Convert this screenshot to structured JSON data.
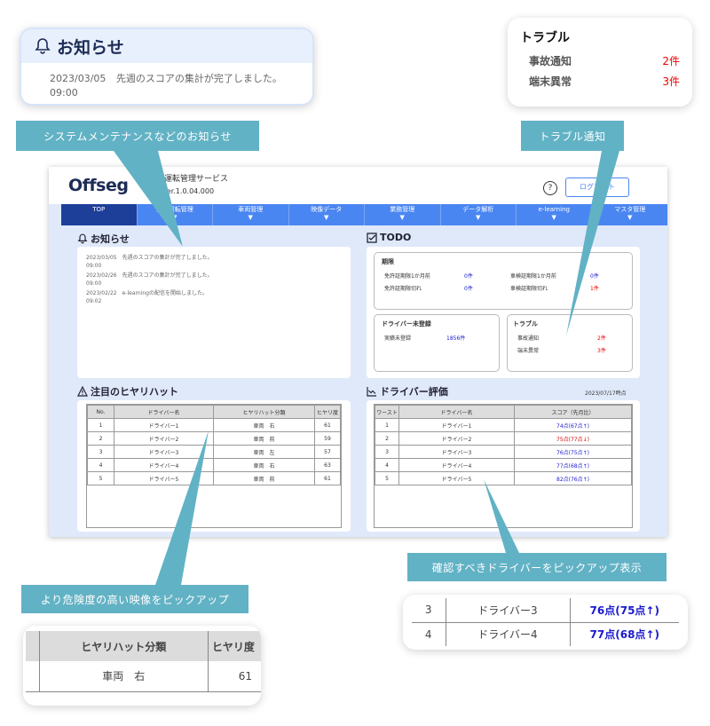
{
  "callout_notice": {
    "title": "お知らせ",
    "date": "2023/03/05",
    "text": "先週のスコアの集計が完了しました。",
    "time": "09:00"
  },
  "callout_trouble": {
    "title": "トラブル",
    "rows": [
      {
        "label": "事故通知",
        "value": "2件"
      },
      {
        "label": "端末異常",
        "value": "3件"
      }
    ]
  },
  "tags": {
    "system": "システムメンテナンスなどのお知らせ",
    "trouble": "トラブル通知",
    "hiyari": "より危険度の高い映像をピックアップ",
    "driver": "確認すべきドライバーをピックアップ表示"
  },
  "app": {
    "logo": "Offseg",
    "service": "安全運転管理サービス",
    "version": "Ver.1.0.04.000",
    "help": "?",
    "logout": "ログアウト",
    "nav": [
      "TOP",
      "安全運転管理",
      "車両管理",
      "映像データ",
      "業務管理",
      "データ解析",
      "e-learning",
      "マスタ管理"
    ],
    "nav_arrow": "▼",
    "notice": {
      "title": "お知らせ",
      "items": [
        {
          "date": "2023/03/05",
          "text": "先週のスコアの集計が完了しました。",
          "time": "09:00"
        },
        {
          "date": "2023/02/26",
          "text": "先週のスコアの集計が完了しました。",
          "time": "09:00"
        },
        {
          "date": "2023/02/22",
          "text": "e-learningの配信を開始しました。",
          "time": "09:02"
        }
      ]
    },
    "todo": {
      "title": "TODO",
      "limit": {
        "title": "期限",
        "rows": [
          {
            "l1": "免許証期限1か月前",
            "v1": "0件",
            "l2": "車検証期限1か月前",
            "v2": "0件"
          },
          {
            "l1": "免許証期限切れ",
            "v1": "0件",
            "l2": "車検証期限切れ",
            "v2": "1件"
          }
        ]
      },
      "unreg": {
        "title": "ドライバー未登録",
        "label": "実績未登録",
        "value": "1856件"
      },
      "trouble": {
        "title": "トラブル",
        "rows": [
          {
            "label": "事故通知",
            "value": "2件"
          },
          {
            "label": "端末異常",
            "value": "3件"
          }
        ]
      }
    },
    "hiyari": {
      "title": "注目のヒヤリハット",
      "headers": [
        "No.",
        "ドライバー名",
        "ヒヤリハット分類",
        "ヒヤリ度"
      ],
      "rows": [
        [
          "1",
          "ドライバー1",
          "車両　右",
          "61"
        ],
        [
          "2",
          "ドライバー2",
          "車両　前",
          "59"
        ],
        [
          "3",
          "ドライバー3",
          "車両　左",
          "57"
        ],
        [
          "4",
          "ドライバー4",
          "車両　右",
          "63"
        ],
        [
          "5",
          "ドライバー5",
          "車両　前",
          "61"
        ]
      ]
    },
    "driver_eval": {
      "title": "ドライバー評価",
      "date": "2023/07/17時点",
      "headers": [
        "ワースト",
        "ドライバー名",
        "スコア（先月比）"
      ],
      "rows": [
        [
          "1",
          "ドライバー1",
          "74点(67点↑)"
        ],
        [
          "2",
          "ドライバー2",
          "75点(77点↓)"
        ],
        [
          "3",
          "ドライバー3",
          "76点(75点↑)"
        ],
        [
          "4",
          "ドライバー4",
          "77点(68点↑)"
        ],
        [
          "5",
          "ドライバー5",
          "82点(76点↑)"
        ]
      ]
    }
  },
  "callout_hiyari": {
    "headers": [
      "ヒヤリハット分類",
      "ヒヤリ度"
    ],
    "row": [
      "車両　右",
      "61"
    ]
  },
  "callout_driver": {
    "rows": [
      [
        "3",
        "ドライバー3",
        "76点(75点↑)"
      ],
      [
        "4",
        "ドライバー4",
        "77点(68点↑)"
      ]
    ]
  },
  "colors": {
    "accent": "#4a86f2",
    "tag": "#62b2c5",
    "navy": "#1d3f9a",
    "up": "#1a1acc",
    "down": "#dd0000"
  }
}
